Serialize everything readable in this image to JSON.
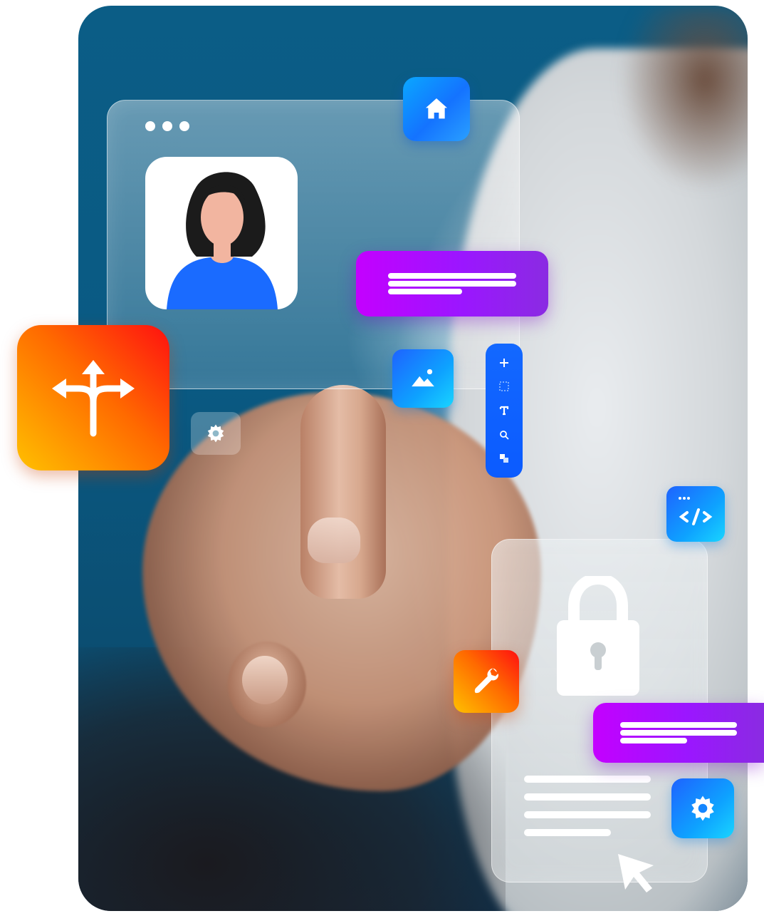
{
  "scene": {
    "description_icons": [
      "home-icon",
      "user-avatar",
      "message-card",
      "image-icon",
      "split-arrows-icon",
      "gear-icon",
      "design-toolbar",
      "code-icon",
      "lock-icon",
      "wrench-icon",
      "cursor-icon"
    ]
  },
  "colors": {
    "bg_blue": "#0b5d86",
    "tile_blue": "#1473ff",
    "tile_orange": "#ff6a00",
    "tile_purple": "#9b16ff",
    "avatar_shirt": "#1a6bff",
    "avatar_hair": "#1b1b1b",
    "avatar_skin": "#f2b5a0"
  },
  "toolbar": {
    "tools": [
      "move-icon",
      "marquee-select-icon",
      "text-tool-icon",
      "zoom-icon",
      "layers-icon"
    ]
  }
}
